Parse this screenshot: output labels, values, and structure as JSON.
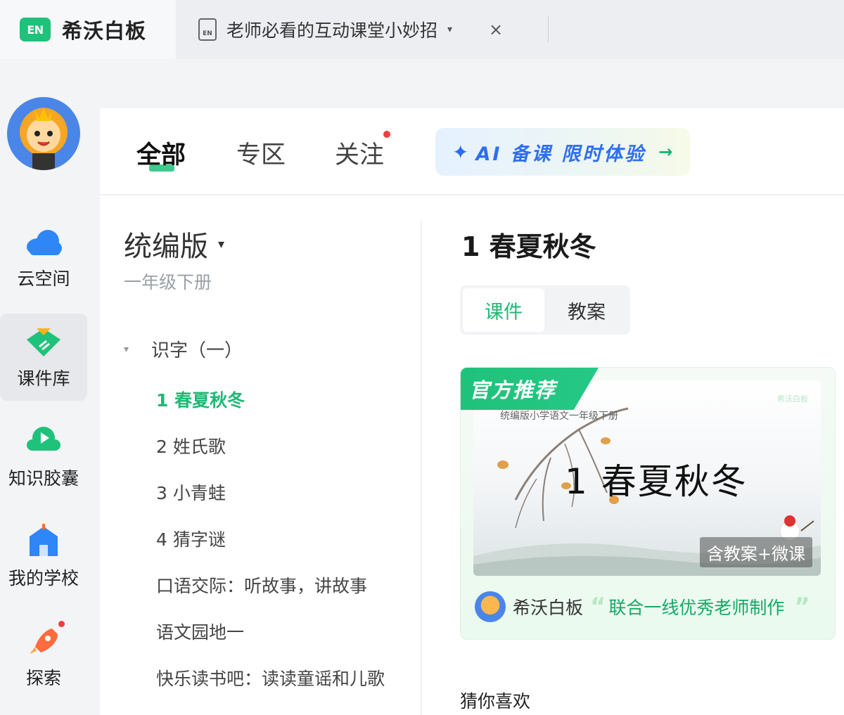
{
  "titlebar": {
    "app_name": "希沃白板",
    "app_logo_text": "EN",
    "doc_icon_text": "EN",
    "doc_title": "老师必看的互动课堂小妙招",
    "doc_caret": "▾",
    "close_glyph": "×"
  },
  "sidebar": {
    "items": [
      {
        "label": "云空间",
        "icon": "cloud-icon"
      },
      {
        "label": "课件库",
        "icon": "courseware-library-icon",
        "active": true
      },
      {
        "label": "知识胶囊",
        "icon": "knowledge-capsule-icon"
      },
      {
        "label": "我的学校",
        "icon": "school-icon"
      },
      {
        "label": "探索",
        "icon": "rocket-icon"
      }
    ]
  },
  "categories": {
    "tabs": [
      {
        "label": "全部",
        "active": true
      },
      {
        "label": "专区"
      },
      {
        "label": "关注",
        "has_notification": true
      }
    ],
    "ai_banner": {
      "star_glyph": "✦",
      "text": "AI 备课 限时体验",
      "arrow": "→"
    }
  },
  "catalog": {
    "edition": "统编版",
    "edition_caret": "▾",
    "grade": "一年级下册",
    "unit_caret": "▾",
    "unit": "识字（一）",
    "lessons": [
      {
        "label": "1 春夏秋冬",
        "active": true
      },
      {
        "label": "2 姓氏歌"
      },
      {
        "label": "3 小青蛙"
      },
      {
        "label": "4 猜字谜"
      },
      {
        "label": "口语交际：听故事，讲故事"
      },
      {
        "label": "语文园地一"
      },
      {
        "label": "快乐读书吧：读读童谣和儿歌"
      }
    ]
  },
  "detail": {
    "title": "1 春夏秋冬",
    "segments": [
      {
        "label": "课件",
        "active": true
      },
      {
        "label": "教案"
      }
    ],
    "card": {
      "official_tag": "官方推荐",
      "thumb_series": "统编版小学语文一年级下册",
      "thumb_brand": "希沃白板",
      "thumb_title": "1  春夏秋冬",
      "thumb_badge": "含教案+微课",
      "author": "希沃白板",
      "quote_open": "“",
      "slogan": "联合一线优秀老师制作",
      "quote_close": "”"
    },
    "guess_label": "猜你喜欢"
  },
  "colors": {
    "accent_green": "#1fc27a",
    "ai_blue": "#2f6ff0",
    "notification_red": "#f03e3e"
  }
}
